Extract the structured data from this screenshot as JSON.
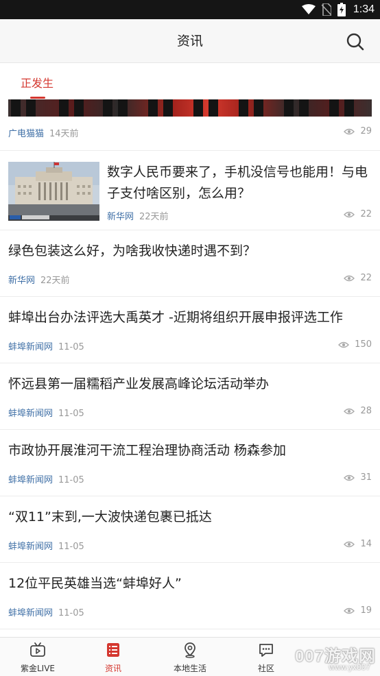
{
  "status_bar": {
    "time": "1:34"
  },
  "header": {
    "title": "资讯"
  },
  "tabs": [
    {
      "label": "正发生",
      "active": true
    }
  ],
  "feed": {
    "partial_item": {
      "source": "广电猫猫",
      "time": "14天前",
      "views": "29"
    },
    "items": [
      {
        "title": "数字人民币要来了，手机没信号也能用！与电子支付啥区别，怎么用？",
        "source": "新华网",
        "time": "22天前",
        "views": "22",
        "has_thumbnail": true
      },
      {
        "title": "绿色包装这么好，为啥我收快递时遇不到？",
        "source": "新华网",
        "time": "22天前",
        "views": "22"
      },
      {
        "title": "蚌埠出台办法评选大禹英才 -近期将组织开展申报评选工作",
        "source": "蚌埠新闻网",
        "time": "11-05",
        "views": "150"
      },
      {
        "title": "怀远县第一届糯稻产业发展高峰论坛活动举办",
        "source": "蚌埠新闻网",
        "time": "11-05",
        "views": "28"
      },
      {
        "title": "市政协开展淮河干流工程治理协商活动 杨森参加",
        "source": "蚌埠新闻网",
        "time": "11-05",
        "views": "31"
      },
      {
        "title": "“双11”末到,一大波快递包裹已抵达",
        "source": "蚌埠新闻网",
        "time": "11-05",
        "views": "14"
      },
      {
        "title": "12位平民英雄当选“蚌埠好人”",
        "source": "蚌埠新闻网",
        "time": "11-05",
        "views": "19"
      }
    ]
  },
  "bottom_nav": [
    {
      "label": "紫金LIVE",
      "icon": "tv-icon",
      "active": false
    },
    {
      "label": "资讯",
      "icon": "news-list-icon",
      "active": true
    },
    {
      "label": "本地生活",
      "icon": "location-pin-icon",
      "active": false
    },
    {
      "label": "社区",
      "icon": "chat-bubble-icon",
      "active": false
    }
  ],
  "watermark": {
    "text": "007游戏网",
    "url": "www.yx007"
  },
  "colors": {
    "accent": "#d4372f",
    "source_link": "#3f6fa6",
    "meta": "#999999"
  }
}
